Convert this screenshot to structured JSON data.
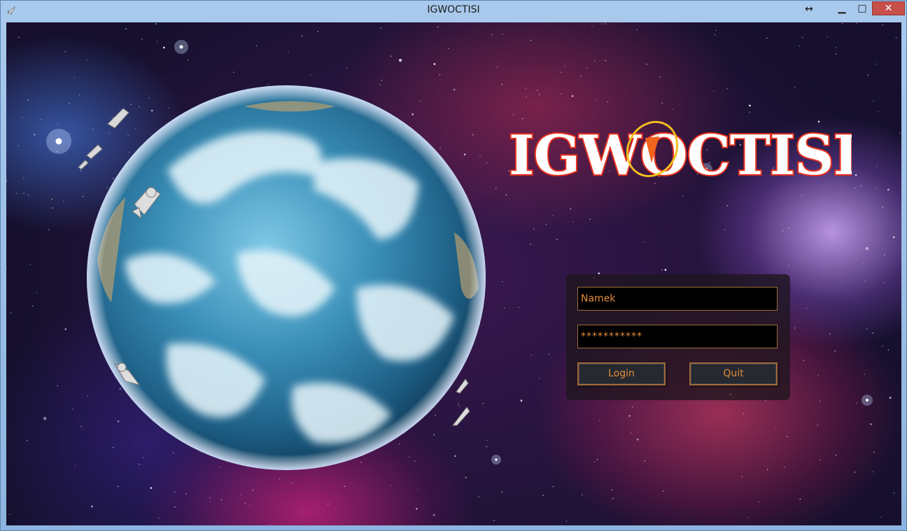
{
  "window": {
    "title": "IGWOCTISI",
    "icons": {
      "app": "spaceship-icon",
      "resize": "resize-arrows-icon",
      "minimize": "minimize-icon",
      "maximize": "maximize-icon",
      "close": "close-icon"
    },
    "controls": {
      "minimize": "▁",
      "maximize": "□",
      "close": "✕",
      "resize": "↔"
    }
  },
  "logo": {
    "text": "IGWOCTISI"
  },
  "login": {
    "username_value": "Namek",
    "password_value": "***********",
    "login_label": "Login",
    "quit_label": "Quit"
  },
  "colors": {
    "accent": "#e08a3a",
    "logo_fill": "#ffffff",
    "logo_stroke": "#e8301c",
    "field_border": "#a06a3a"
  }
}
